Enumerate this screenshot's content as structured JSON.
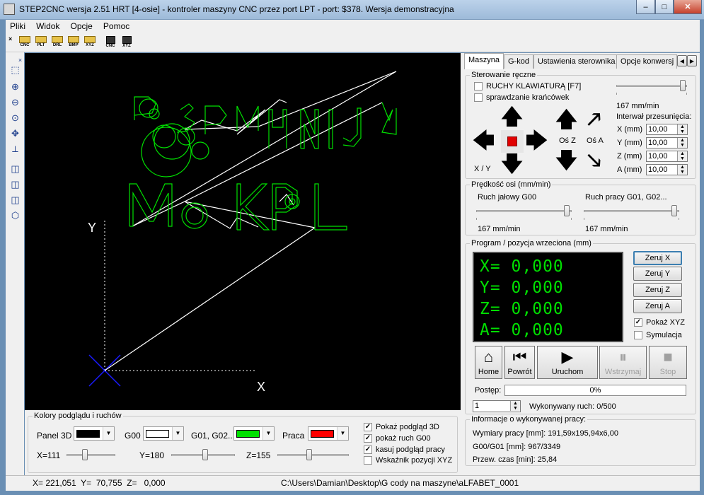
{
  "window": {
    "title": "STEP2CNC wersja 2.51 HRT [4-osie] - kontroler maszyny CNC przez port LPT - port: $378. Wersja demonstracyjna",
    "minimize": "–",
    "maximize": "□",
    "close": "✕"
  },
  "menu": [
    "Pliki",
    "Widok",
    "Opcje",
    "Pomoc"
  ],
  "toolbar": [
    {
      "label": "CNC",
      "icon": "open-folder-icon"
    },
    {
      "label": "PLT",
      "icon": "open-folder-icon"
    },
    {
      "label": "DRL",
      "icon": "open-folder-icon"
    },
    {
      "label": "BMP",
      "icon": "open-folder-icon"
    },
    {
      "label": "XYZ",
      "icon": "open-folder-icon"
    },
    {
      "label": "CNC",
      "icon": "save-disk-icon"
    },
    {
      "label": "XYZ",
      "icon": "save-disk-icon"
    }
  ],
  "canvas": {
    "axis_y": "Y",
    "axis_x": "X"
  },
  "colors_panel": {
    "title": "Kolory podglądu i ruchów",
    "panel3d_label": "Panel 3D",
    "panel3d_color": "#000000",
    "g00_label": "G00",
    "g00_color": "#ffffff",
    "g01_label": "G01, G02...",
    "g01_color": "#00e000",
    "praca_label": "Praca",
    "praca_color": "#ff0000",
    "x_label": "X=111",
    "y_label": "Y=180",
    "z_label": "Z=155",
    "x_value": 111,
    "y_value": 180,
    "z_value": 155,
    "checks": [
      {
        "label": "Pokaż podgląd 3D",
        "checked": true
      },
      {
        "label": "pokaż ruch G00",
        "checked": true
      },
      {
        "label": "kasuj podgląd pracy",
        "checked": true
      },
      {
        "label": "Wskaźnik pozycji XYZ",
        "checked": false
      }
    ]
  },
  "tabs": [
    "Maszyna",
    "G-kod",
    "Ustawienia sterownika",
    "Opcje konwersj"
  ],
  "manual": {
    "title": "Sterowanie ręczne",
    "keyboard_label": "RUCHY KLAWIATURĄ [F7]",
    "keyboard_checked": false,
    "limit_label": "sprawdzanie krańcówek",
    "limit_checked": false,
    "speed": "167 mm/min",
    "interval_label": "Interwał przesunięcia:",
    "x_label": "X (mm)",
    "y_label": "Y (mm)",
    "z_label": "Z (mm)",
    "a_label": "A (mm)",
    "x_value": "10,00",
    "y_value": "10,00",
    "z_value": "10,00",
    "a_value": "10,00",
    "xy_label": "X / Y",
    "osz_label": "Oś Z",
    "osa_label": "Oś A"
  },
  "axis_speed": {
    "title": "Prędkość osi (mm/min)",
    "g00_label": "Ruch jałowy G00",
    "g01_label": "Ruch pracy G01, G02...",
    "g00_value": "167 mm/min",
    "g01_value": "167 mm/min"
  },
  "program": {
    "title": "Program / pozycja wrzeciona (mm)",
    "x": "X= 0,000",
    "y": "Y= 0,000",
    "z": "Z= 0,000",
    "a": "A= 0,000",
    "zero_x": "Zeruj X",
    "zero_y": "Zeruj Y",
    "zero_z": "Zeruj Z",
    "zero_a": "Zeruj A",
    "show_xyz": "Pokaż XYZ",
    "show_xyz_checked": true,
    "simulation": "Symulacja",
    "simulation_checked": false,
    "home": "Home",
    "back": "Powrót",
    "run": "Uruchom",
    "pause": "Wstrzymaj",
    "stop": "Stop",
    "progress_label": "Postęp:",
    "progress_text": "0%",
    "progress_value": 0,
    "step_value": "1",
    "executed": "Wykonywany ruch: 0/500"
  },
  "info": {
    "title": "Informacje o wykonywanej pracy:",
    "dims": "Wymiary pracy [mm]: 191,59x195,94x6,00",
    "g00g01": "G00/G01 [mm]: 967/3349",
    "time": "Przew. czas [min]: 25,84"
  },
  "status": {
    "coords": "X= 221,051  Y=  70,755  Z=   0,000",
    "file": "C:\\Users\\Damian\\Desktop\\G cody na maszyne\\aLFABET_0001"
  },
  "colors": {
    "accent": "#00e000",
    "stop_red": "#e00000",
    "cross_blue": "#1a1aff"
  }
}
